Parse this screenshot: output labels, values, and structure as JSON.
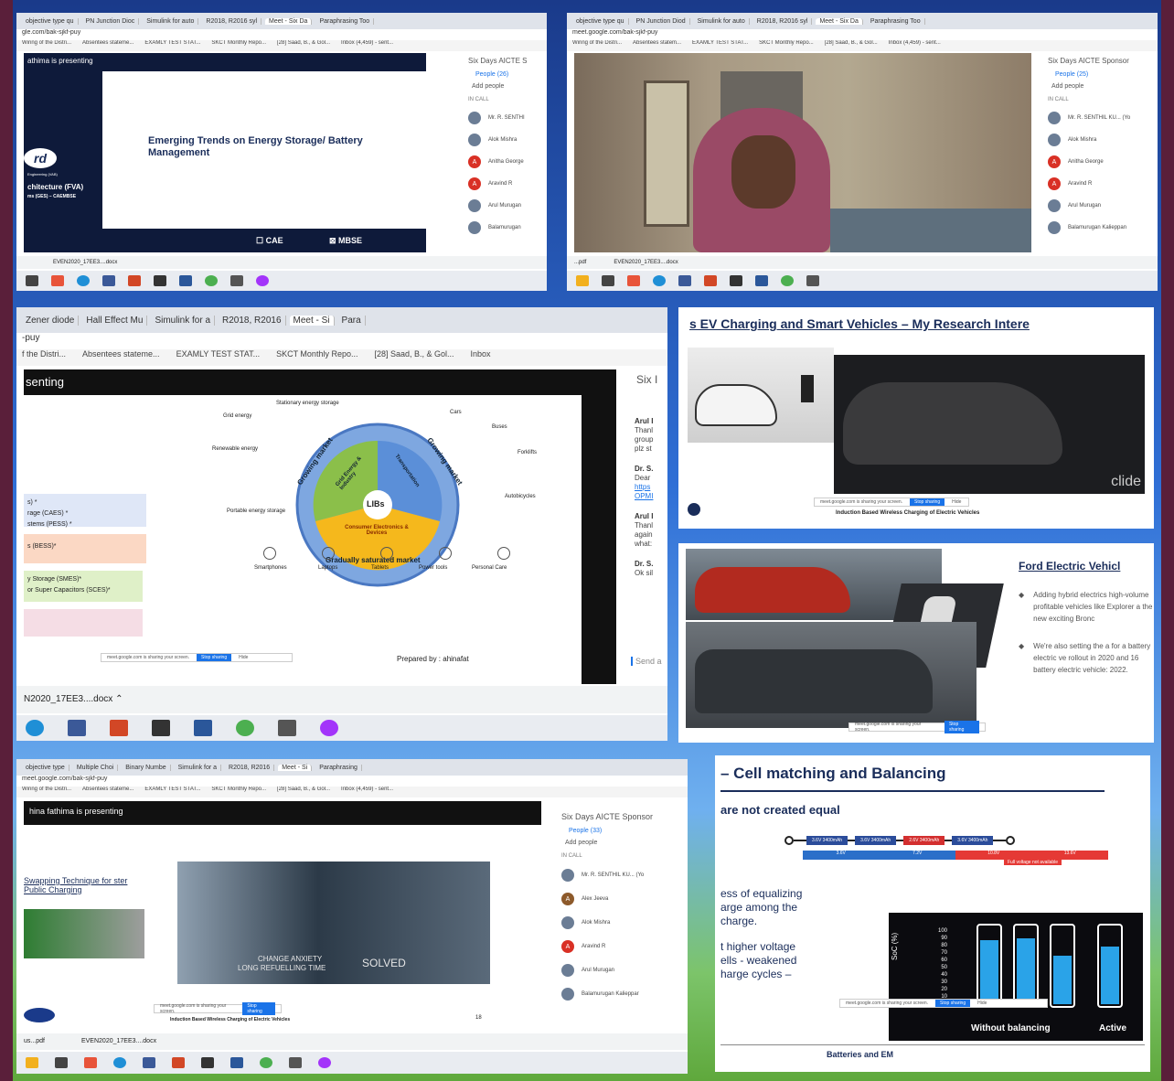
{
  "p1": {
    "tabs": [
      "objective type qu",
      "PN Junction Dioc",
      "Simulink for auto",
      "R2018, R2016 syl",
      "Meet - Six Da",
      "Paraphrasing Too"
    ],
    "url": "gle.com/bak-sjkf-puy",
    "bookmarks": [
      "Wiring of the Distri...",
      "Absentees stateme...",
      "EXAMLY TEST STAT...",
      "SKCT Monthly Repo...",
      "[28] Saad, B., & Gol...",
      "Inbox (4,459) - sent..."
    ],
    "presenting": "athima is presenting",
    "slide_title": "Emerging Trends on Energy Storage/ Battery Management",
    "left_logo": "rd",
    "left_sub1": "Engineering (VAB)",
    "left_arch": "chitecture (FVA)",
    "left_sub2": "ms (GES) – CAEMBSE",
    "cae": "CAE",
    "mbse": "MBSE",
    "side_title": "Six Days AICTE S",
    "people": "People (26)",
    "add": "Add people",
    "incall": "IN CALL",
    "participants": [
      "Mr. R. SENTHI",
      "Alok Mishra",
      "Anitha George",
      "Aravind R",
      "Arul Murugan",
      "Balamurugan"
    ],
    "download": "EVEN2020_17EE3....docx"
  },
  "p2": {
    "tabs": [
      "objective type qu",
      "PN Junction Diod",
      "Simulink for auto",
      "R2018, R2016 syl",
      "Meet - Six Da",
      "Paraphrasing Too"
    ],
    "url": "meet.google.com/bak-sjkf-puy",
    "bookmarks": [
      "Wiring of the Distri...",
      "Absentees statem...",
      "EXAMLY TEST STAT...",
      "SKCT Monthly Repo...",
      "[28] Saad, B., & Gol...",
      "Inbox (4,459) - sent..."
    ],
    "side_title": "Six Days AICTE Sponsor",
    "people": "People (25)",
    "add": "Add people",
    "incall": "IN CALL",
    "participants": [
      "Mr. R. SENTHIL KU... (Yo",
      "Alok Mishra",
      "Anitha George",
      "Aravind R",
      "Arul Murugan",
      "Balamurugan Kalieppan"
    ],
    "download": "EVEN2020_17EE3....docx",
    "download2": "...pdf"
  },
  "p3": {
    "tabs": [
      "Zener diode",
      "Hall Effect Mu",
      "Simulink for a",
      "R2018, R2016",
      "Meet - Si",
      "Para"
    ],
    "url": "-puy",
    "bookmarks": [
      "f the Distri...",
      "Absentees stateme...",
      "EXAMLY TEST STAT...",
      "SKCT Monthly Repo...",
      "[28] Saad, B., & Gol...",
      "Inbox"
    ],
    "presenting": "senting",
    "center": "LIBs",
    "ring_growing1": "Growing market",
    "ring_growing2": "Growing market",
    "ring_grid": "Grid Energy & Industry",
    "ring_transport": "Transportation",
    "ring_consumer": "Consumer Electronics & Devices",
    "ring_saturated": "Gradually saturated market",
    "labels": {
      "stationary": "Stationary energy storage",
      "grid": "Grid energy",
      "renewable": "Renewable energy",
      "portable": "Portable energy storage",
      "cars": "Cars",
      "buses": "Buses",
      "forklifts": "Forklifts",
      "autobicycles": "Autobicycles",
      "smartphones": "Smartphones",
      "laptops": "Laptops",
      "tablets": "Tablets",
      "powertools": "Power tools",
      "personalcare": "Personal Care"
    },
    "left_items": [
      "s) *",
      "rage (CAES) *",
      "stems (PESS) *",
      "s (BESS)*",
      "y Storage (SMES)*",
      "or Super Capacitors (SCES)*"
    ],
    "prepared": "Prepared by : ahinafat",
    "side_title": "Six I",
    "chat": [
      {
        "name": "Arul I",
        "lines": [
          "Thanl",
          "group",
          "plz st"
        ]
      },
      {
        "name": "Dr. S.",
        "lines": [
          "Dear"
        ],
        "links": [
          "https",
          "OPMI"
        ]
      },
      {
        "name": "Arul I",
        "lines": [
          "Thanl",
          "again",
          "what:"
        ]
      },
      {
        "name": "Dr. S.",
        "lines": [
          "Ok sil"
        ]
      }
    ],
    "send": "Send a",
    "download": "N2020_17EE3....docx",
    "share_text": "meet.google.com is sharing your screen.",
    "share_stop": "Stop sharing",
    "share_hide": "Hide"
  },
  "p4": {
    "title": "s EV Charging and Smart Vehicles – My Research Intere",
    "caption": "Induction Based Wireless Charging of Electric Vehicles",
    "watermark": "clide",
    "share_text": "meet.google.com is sharing your screen.",
    "share_stop": "Stop sharing",
    "share_hide": "Hide"
  },
  "p5": {
    "title": "Ford Electric Vehicl",
    "bullets": [
      "Adding hybrid electrics high-volume profitable vehicles like Explorer a the new exciting Bronc",
      "We're also setting the a for a battery electric ve rollout in 2020 and 16 battery electric vehicle: 2022."
    ],
    "share_text": "meet.google.com is sharing your screen.",
    "share_stop": "Stop sharing"
  },
  "p6": {
    "tabs": [
      "objective type",
      "Multiple Choi",
      "Binary Numbe",
      "Simulink for a",
      "R2018, R2016",
      "Meet - Si",
      "Paraphrasing"
    ],
    "url": "meet.google.com/bak-sjkf-puy",
    "bookmarks": [
      "Wiring of the Distri...",
      "Absentees stateme...",
      "EXAMLY TEST STAT...",
      "SKCT Monthly Repo...",
      "[28] Saad, B., & Gol...",
      "Inbox (4,459) - sent..."
    ],
    "presenting": "hina fathima is presenting",
    "slide_title": "Swapping Technique for ster Public Charging",
    "video_text1": "CHANGE ANXIETY",
    "video_text2": "LONG REFUELLING TIME",
    "video_text3": "SOLVED",
    "caption": "Induction Based Wireless Charging of Electric Vehicles",
    "page_num": "18",
    "side_title": "Six Days AICTE Sponsor",
    "people": "People (33)",
    "add": "Add people",
    "incall": "IN CALL",
    "participants": [
      "Mr. R. SENTHIL KU... (Yo",
      "Alex Jeeva",
      "Alok Mishra",
      "Aravind R",
      "Arul Murugan",
      "Balamurugan Kalieppar"
    ],
    "download": "EVEN2020_17EE3....docx",
    "download2": "us...pdf"
  },
  "p7": {
    "title": "– Cell matching and Balancing",
    "subtitle": "are not created equal",
    "cells": [
      "3.6V 3400mAh",
      "3.6V 3400mAh",
      "2.6V 3400mAh",
      "3.6V 3400mAh"
    ],
    "volts": [
      "3.6V",
      "7.2V",
      "10.8V",
      "13.6V"
    ],
    "full_note": "Full voltage not available",
    "body1": [
      "ess of equalizing",
      "arge among the",
      "charge."
    ],
    "body2": [
      "t higher voltage",
      "ells - weakened",
      "harge cycles –"
    ],
    "ylabel": "SoC (%)",
    "yticks": [
      "100",
      "90",
      "80",
      "70",
      "60",
      "50",
      "40",
      "30",
      "20",
      "10",
      "0"
    ],
    "bottom_left": "Without balancing",
    "bottom_right": "Active",
    "footer": "Batteries and EM",
    "share_text": "meet.google.com is sharing your screen.",
    "share_stop": "Stop sharing",
    "share_hide": "Hide"
  }
}
